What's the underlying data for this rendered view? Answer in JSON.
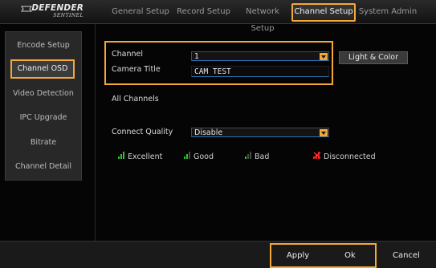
{
  "brand": {
    "name": "DEFENDER",
    "tagline": "SENTINEL"
  },
  "top_tabs": [
    {
      "label": "General Setup",
      "active": false
    },
    {
      "label": "Record Setup",
      "active": false
    },
    {
      "label": "Network Setup",
      "active": false
    },
    {
      "label": "Channel Setup",
      "active": true
    },
    {
      "label": "System Admin",
      "active": false
    }
  ],
  "sidebar": {
    "items": [
      {
        "label": "Encode Setup",
        "active": false
      },
      {
        "label": "Channel OSD",
        "active": true
      },
      {
        "label": "Video Detection",
        "active": false
      },
      {
        "label": "IPC Upgrade",
        "active": false
      },
      {
        "label": "Bitrate",
        "active": false
      },
      {
        "label": "Channel Detail",
        "active": false
      }
    ]
  },
  "form": {
    "channel_label": "Channel",
    "channel_value": "1",
    "camera_title_label": "Camera Title",
    "camera_title_value": "CAM TEST",
    "light_color_button": "Light & Color",
    "all_channels_label": "All Channels",
    "connect_quality_label": "Connect Quality",
    "connect_quality_value": "Disable"
  },
  "legend": [
    {
      "label": "Excellent",
      "icon": "signal-excellent-icon",
      "color": "#2fc02f"
    },
    {
      "label": "Good",
      "icon": "signal-good-icon",
      "color": "#2fc02f"
    },
    {
      "label": "Bad",
      "icon": "signal-bad-icon",
      "color": "#2fc02f"
    },
    {
      "label": "Disconnected",
      "icon": "signal-disconnected-icon",
      "color": "#e02020"
    }
  ],
  "footer": {
    "apply": "Apply",
    "ok": "Ok",
    "cancel": "Cancel"
  },
  "colors": {
    "accent_highlight": "#f3a838",
    "panel": "#282828",
    "background": "#050505"
  }
}
